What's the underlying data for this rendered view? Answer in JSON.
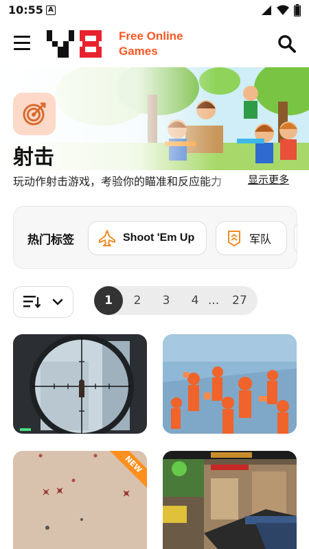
{
  "status_bar": {
    "time": "10:55",
    "notification_glyph": "A"
  },
  "header": {
    "brand_line1": "Free Online",
    "brand_line2": "Games",
    "brand_color": "#ff5722"
  },
  "category": {
    "title": "射击",
    "description": "玩动作射击游戏，考验你的瞄准和反应能力",
    "show_more": "显示更多",
    "icon": "target-icon"
  },
  "tags": {
    "label": "热门标签",
    "items": [
      {
        "label": "Shoot 'Em Up",
        "icon": "jet-icon"
      },
      {
        "label": "军队",
        "icon": "military-rank-icon"
      }
    ]
  },
  "pagination": {
    "pages": [
      "1",
      "2",
      "3",
      "4"
    ],
    "ellipsis": "...",
    "last": "27",
    "current": "1"
  },
  "games": [
    {
      "thumb": "sniper-scope-thumbnail"
    },
    {
      "thumb": "orange-figures-thumbnail"
    },
    {
      "thumb": "desert-map-thumbnail",
      "badge": "NEW"
    },
    {
      "thumb": "counter-strike-thumbnail"
    }
  ]
}
